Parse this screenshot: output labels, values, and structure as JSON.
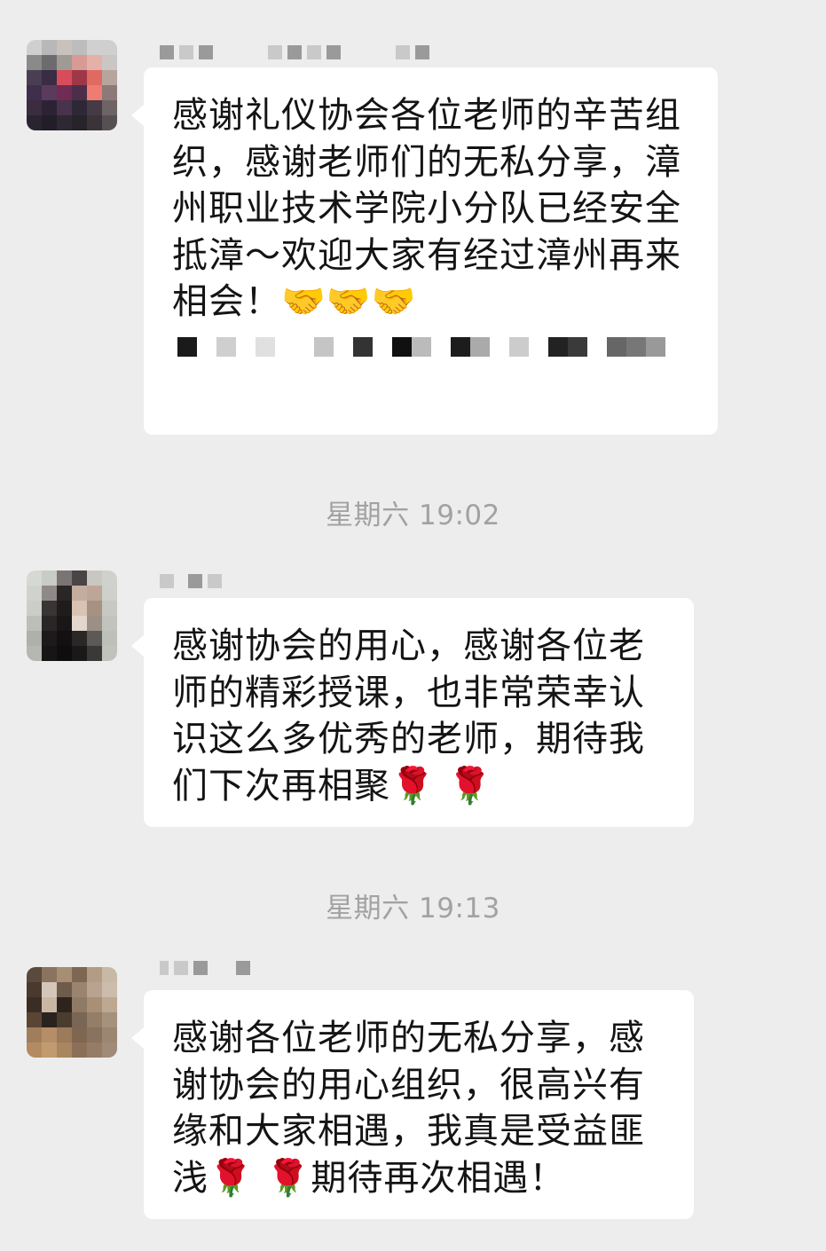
{
  "messages": [
    {
      "sender_name_visible": false,
      "text": "感谢礼仪协会各位老师的辛苦组织，感谢老师们的无私分享，漳州职业技术学院小分队已经安全抵漳～欢迎大家有经过漳州再来相会！🤝🤝🤝",
      "avatar_icon": "pixelated-avatar-icon"
    },
    {
      "sender_name_visible": false,
      "text": "感谢协会的用心，感谢各位老师的精彩授课，也非常荣幸认识这么多优秀的老师，期待我们下次再相聚🌹 🌹",
      "avatar_icon": "pixelated-avatar-icon"
    },
    {
      "sender_name_visible": false,
      "text": "感谢各位老师的无私分享，感谢协会的用心组织，很高兴有缘和大家相遇，我真是受益匪浅🌹 🌹期待再次相遇！",
      "avatar_icon": "pixelated-avatar-icon"
    }
  ],
  "timestamps": [
    "星期六 19:02",
    "星期六 19:13"
  ],
  "colors": {
    "background": "#ededed",
    "bubble": "#ffffff",
    "text": "#141414",
    "timestamp": "#a2a2a2"
  }
}
